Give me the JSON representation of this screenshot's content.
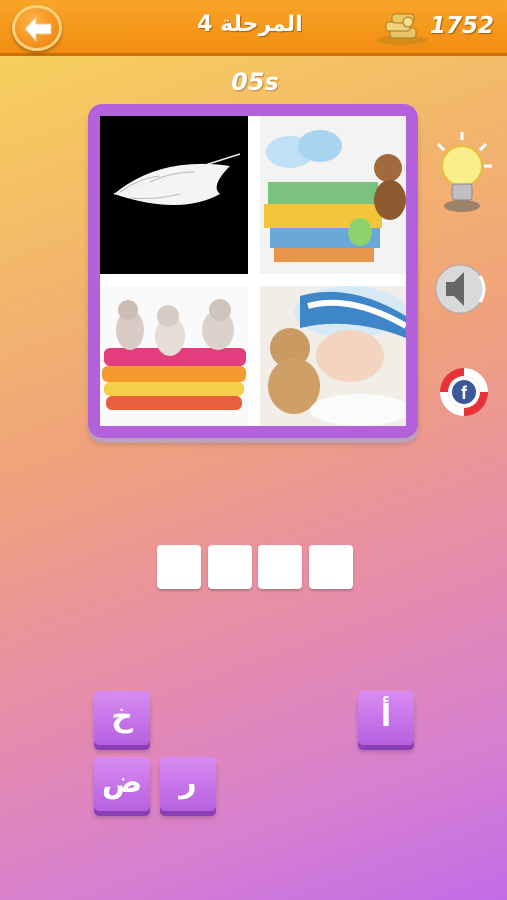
{
  "header": {
    "back_icon": "arrow-left-icon",
    "level_title": "المرحلة 4",
    "coins_icon": "coins-stack-icon",
    "coins": "1752"
  },
  "timer": "05s",
  "puzzle": {
    "images": [
      "feather-photo",
      "baby-clothes-photo",
      "kittens-on-towels-photo",
      "sleeping-baby-photo"
    ]
  },
  "tools": [
    "lightbulb-hint-icon",
    "speaker-icon",
    "facebook-lifebuoy-icon"
  ],
  "answer": {
    "slot_count": 4
  },
  "letters": [
    "خ",
    "أ",
    "ض",
    "ر"
  ],
  "colors": {
    "header": "#f39a1f",
    "tile": "#c877ea",
    "frame": "#b461dc"
  }
}
